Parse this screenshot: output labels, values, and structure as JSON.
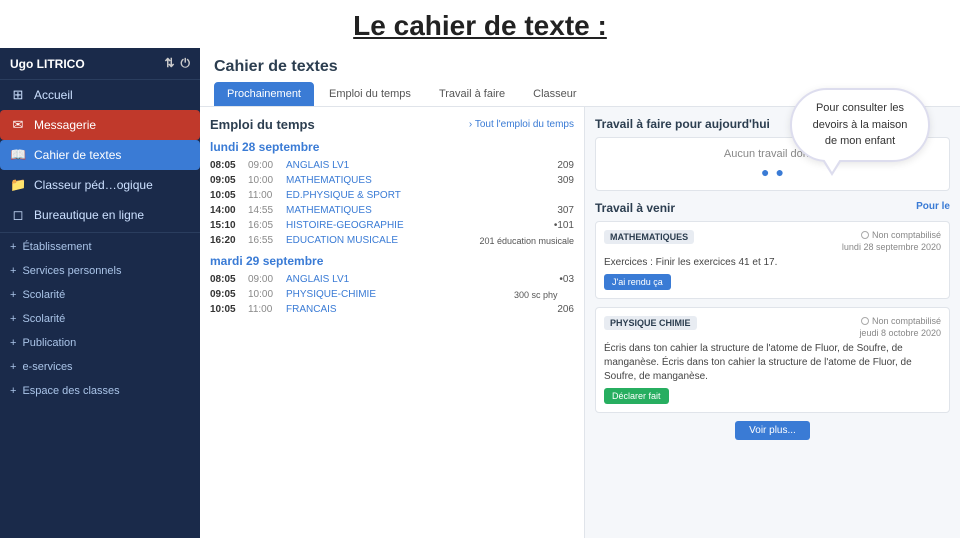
{
  "page": {
    "title": "Le cahier de texte :"
  },
  "callout": {
    "text": "Pour consulter les devoirs à la maison  de mon enfant"
  },
  "sidebar": {
    "user": "Ugo LITRICO",
    "items": [
      {
        "id": "accueil",
        "label": "Accueil",
        "icon": "⊞",
        "active": false
      },
      {
        "id": "messagerie",
        "label": "Messagerie",
        "icon": "✉",
        "active": false,
        "highlighted": true
      },
      {
        "id": "cahier",
        "label": "Cahier de textes",
        "icon": "📖",
        "active": true
      },
      {
        "id": "classeur",
        "label": "Classeur péd…ogique",
        "icon": "📁",
        "active": false
      },
      {
        "id": "bureautique",
        "label": "Bureautique en ligne",
        "icon": "◻",
        "active": false
      }
    ],
    "sections": [
      {
        "id": "etablissement",
        "label": "Établissement"
      },
      {
        "id": "services",
        "label": "Services personnels"
      },
      {
        "id": "scolarite1",
        "label": "Scolarité"
      },
      {
        "id": "scolarite2",
        "label": "Scolarité"
      },
      {
        "id": "publication",
        "label": "Publication"
      },
      {
        "id": "eservices",
        "label": "e-services"
      },
      {
        "id": "espace",
        "label": "Espace des classes"
      }
    ]
  },
  "content": {
    "header_title": "Cahier de textes",
    "tabs": [
      {
        "id": "prochainement",
        "label": "Prochainement",
        "active": true
      },
      {
        "id": "emploi",
        "label": "Emploi du temps",
        "active": false
      },
      {
        "id": "travail",
        "label": "Travail à faire",
        "active": false
      },
      {
        "id": "classeur",
        "label": "Classeur",
        "active": false
      }
    ],
    "left_panel": {
      "title": "Emploi du temps",
      "link": "› Tout l'emploi du temps",
      "days": [
        {
          "date": "lundi 28 septembre",
          "slots": [
            {
              "start": "08:05",
              "end": "09:00",
              "subject": "ANGLAIS LV1",
              "room": "209"
            },
            {
              "start": "09:05",
              "end": "10:00",
              "subject": "MATHEMATIQUES",
              "room": "309"
            },
            {
              "start": "10:05",
              "end": "11:00",
              "subject": "ED.PHYSIQUE & SPORT",
              "room": ""
            },
            {
              "start": "14:00",
              "end": "14:55",
              "subject": "MATHEMATIQUES",
              "room": "307"
            },
            {
              "start": "15:10",
              "end": "16:05",
              "subject": "HISTOIRE-GEOGRAPHIE",
              "room": "101"
            },
            {
              "start": "16:20",
              "end": "16:55",
              "subject": "EDUCATION MUSICALE",
              "room": "201",
              "note": "éducation musicale"
            }
          ]
        },
        {
          "date": "mardi 29 septembre",
          "slots": [
            {
              "start": "08:05",
              "end": "09:00",
              "subject": "ANGLAIS LV1",
              "room": "103"
            },
            {
              "start": "09:05",
              "end": "10:00",
              "subject": "PHYSIQUE-CHIMIE",
              "room": "300 sc phy"
            },
            {
              "start": "10:05",
              "end": "11:00",
              "subject": "FRANCAIS",
              "room": "206"
            }
          ]
        }
      ]
    },
    "right_panel": {
      "today_title": "Travail à faire pour aujourd'hui",
      "no_work": "Aucun travail donné",
      "coming_title": "Travail à venir",
      "coming_link": "Pour le",
      "cards": [
        {
          "subject": "MATHEMATIQUES",
          "status": "Non comptabilisé",
          "date": "lundi 28 septembre 2020",
          "text": "Exercices : Finir les exercices 41 et 17.",
          "btn_label": "J'ai rendu ça",
          "btn_type": "blue"
        },
        {
          "subject": "PHYSIQUE CHIMIE",
          "status": "Non comptabilisé",
          "date": "jeudi 8 octobre 2020",
          "text": "Écris dans ton cahier la structure de l'atome de Fluor, de Soufre, de manganèse. Écris dans ton cahier la structure de l'atome de Fluor, de Soufre, de manganèse.",
          "btn_label": "Déclarer fait",
          "btn_type": "green"
        }
      ],
      "voir_plus": "Voir plus..."
    }
  }
}
